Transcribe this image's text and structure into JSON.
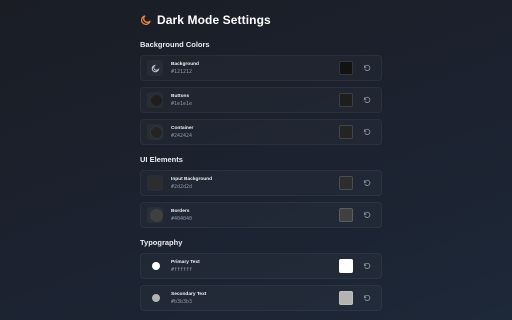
{
  "header": {
    "title": "Dark Mode Settings",
    "icon": "moon-icon"
  },
  "sections": [
    {
      "title": "Background Colors",
      "items": [
        {
          "name": "Background",
          "hex": "#121212",
          "color": "#121212",
          "icon": "moon-icon"
        },
        {
          "name": "Buttons",
          "hex": "#1e1e1e",
          "color": "#1e1e1e",
          "icon": "circle-icon"
        },
        {
          "name": "Container",
          "hex": "#242424",
          "color": "#242424",
          "icon": "circle-icon"
        }
      ]
    },
    {
      "title": "UI Elements",
      "items": [
        {
          "name": "Input Background",
          "hex": "#2d2d2d",
          "color": "#2d2d2d",
          "icon": "square-icon"
        },
        {
          "name": "Borders",
          "hex": "#404040",
          "color": "#404040",
          "icon": "circle-icon"
        }
      ]
    },
    {
      "title": "Typography",
      "items": [
        {
          "name": "Primary Text",
          "hex": "#ffffff",
          "color": "#ffffff",
          "icon": "circle-icon"
        },
        {
          "name": "Secondary Text",
          "hex": "#b3b3b3",
          "color": "#b3b3b3",
          "icon": "circle-icon"
        }
      ]
    }
  ],
  "colors": {
    "accent": "#f0833a",
    "muted": "#8e97a6"
  }
}
